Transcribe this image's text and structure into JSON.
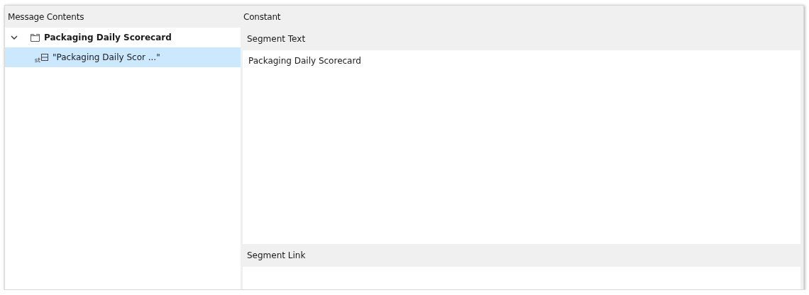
{
  "left_pane": {
    "title": "Message Contents",
    "tree": [
      {
        "kind": "group",
        "label": "Packaging Daily Scorecard",
        "expanded": true,
        "selected": false,
        "children": [
          {
            "kind": "string",
            "type_tag": "st",
            "label": "\"Packaging Daily Scor ...\"",
            "selected": true
          }
        ]
      }
    ]
  },
  "right_pane": {
    "title": "Constant",
    "sections": [
      {
        "title": "Segment Text",
        "value": "Packaging Daily Scorecard",
        "kind": "textarea"
      },
      {
        "title": "Segment Link",
        "kind": "field"
      }
    ]
  }
}
